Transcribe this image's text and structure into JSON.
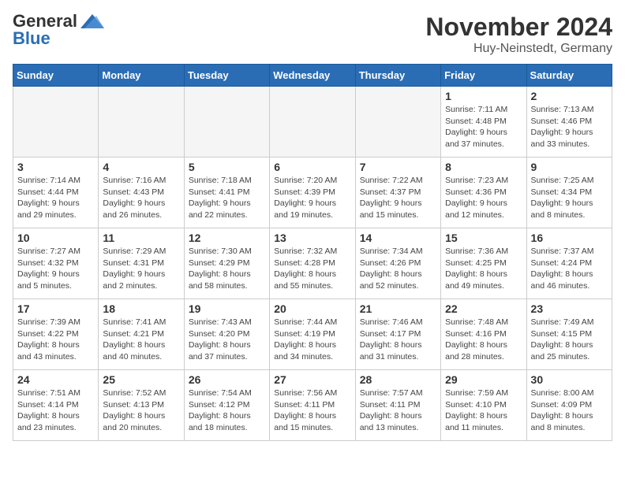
{
  "header": {
    "logo_general": "General",
    "logo_blue": "Blue",
    "month": "November 2024",
    "location": "Huy-Neinstedt, Germany"
  },
  "weekdays": [
    "Sunday",
    "Monday",
    "Tuesday",
    "Wednesday",
    "Thursday",
    "Friday",
    "Saturday"
  ],
  "weeks": [
    [
      {
        "day": "",
        "info": ""
      },
      {
        "day": "",
        "info": ""
      },
      {
        "day": "",
        "info": ""
      },
      {
        "day": "",
        "info": ""
      },
      {
        "day": "",
        "info": ""
      },
      {
        "day": "1",
        "info": "Sunrise: 7:11 AM\nSunset: 4:48 PM\nDaylight: 9 hours\nand 37 minutes."
      },
      {
        "day": "2",
        "info": "Sunrise: 7:13 AM\nSunset: 4:46 PM\nDaylight: 9 hours\nand 33 minutes."
      }
    ],
    [
      {
        "day": "3",
        "info": "Sunrise: 7:14 AM\nSunset: 4:44 PM\nDaylight: 9 hours\nand 29 minutes."
      },
      {
        "day": "4",
        "info": "Sunrise: 7:16 AM\nSunset: 4:43 PM\nDaylight: 9 hours\nand 26 minutes."
      },
      {
        "day": "5",
        "info": "Sunrise: 7:18 AM\nSunset: 4:41 PM\nDaylight: 9 hours\nand 22 minutes."
      },
      {
        "day": "6",
        "info": "Sunrise: 7:20 AM\nSunset: 4:39 PM\nDaylight: 9 hours\nand 19 minutes."
      },
      {
        "day": "7",
        "info": "Sunrise: 7:22 AM\nSunset: 4:37 PM\nDaylight: 9 hours\nand 15 minutes."
      },
      {
        "day": "8",
        "info": "Sunrise: 7:23 AM\nSunset: 4:36 PM\nDaylight: 9 hours\nand 12 minutes."
      },
      {
        "day": "9",
        "info": "Sunrise: 7:25 AM\nSunset: 4:34 PM\nDaylight: 9 hours\nand 8 minutes."
      }
    ],
    [
      {
        "day": "10",
        "info": "Sunrise: 7:27 AM\nSunset: 4:32 PM\nDaylight: 9 hours\nand 5 minutes."
      },
      {
        "day": "11",
        "info": "Sunrise: 7:29 AM\nSunset: 4:31 PM\nDaylight: 9 hours\nand 2 minutes."
      },
      {
        "day": "12",
        "info": "Sunrise: 7:30 AM\nSunset: 4:29 PM\nDaylight: 8 hours\nand 58 minutes."
      },
      {
        "day": "13",
        "info": "Sunrise: 7:32 AM\nSunset: 4:28 PM\nDaylight: 8 hours\nand 55 minutes."
      },
      {
        "day": "14",
        "info": "Sunrise: 7:34 AM\nSunset: 4:26 PM\nDaylight: 8 hours\nand 52 minutes."
      },
      {
        "day": "15",
        "info": "Sunrise: 7:36 AM\nSunset: 4:25 PM\nDaylight: 8 hours\nand 49 minutes."
      },
      {
        "day": "16",
        "info": "Sunrise: 7:37 AM\nSunset: 4:24 PM\nDaylight: 8 hours\nand 46 minutes."
      }
    ],
    [
      {
        "day": "17",
        "info": "Sunrise: 7:39 AM\nSunset: 4:22 PM\nDaylight: 8 hours\nand 43 minutes."
      },
      {
        "day": "18",
        "info": "Sunrise: 7:41 AM\nSunset: 4:21 PM\nDaylight: 8 hours\nand 40 minutes."
      },
      {
        "day": "19",
        "info": "Sunrise: 7:43 AM\nSunset: 4:20 PM\nDaylight: 8 hours\nand 37 minutes."
      },
      {
        "day": "20",
        "info": "Sunrise: 7:44 AM\nSunset: 4:19 PM\nDaylight: 8 hours\nand 34 minutes."
      },
      {
        "day": "21",
        "info": "Sunrise: 7:46 AM\nSunset: 4:17 PM\nDaylight: 8 hours\nand 31 minutes."
      },
      {
        "day": "22",
        "info": "Sunrise: 7:48 AM\nSunset: 4:16 PM\nDaylight: 8 hours\nand 28 minutes."
      },
      {
        "day": "23",
        "info": "Sunrise: 7:49 AM\nSunset: 4:15 PM\nDaylight: 8 hours\nand 25 minutes."
      }
    ],
    [
      {
        "day": "24",
        "info": "Sunrise: 7:51 AM\nSunset: 4:14 PM\nDaylight: 8 hours\nand 23 minutes."
      },
      {
        "day": "25",
        "info": "Sunrise: 7:52 AM\nSunset: 4:13 PM\nDaylight: 8 hours\nand 20 minutes."
      },
      {
        "day": "26",
        "info": "Sunrise: 7:54 AM\nSunset: 4:12 PM\nDaylight: 8 hours\nand 18 minutes."
      },
      {
        "day": "27",
        "info": "Sunrise: 7:56 AM\nSunset: 4:11 PM\nDaylight: 8 hours\nand 15 minutes."
      },
      {
        "day": "28",
        "info": "Sunrise: 7:57 AM\nSunset: 4:11 PM\nDaylight: 8 hours\nand 13 minutes."
      },
      {
        "day": "29",
        "info": "Sunrise: 7:59 AM\nSunset: 4:10 PM\nDaylight: 8 hours\nand 11 minutes."
      },
      {
        "day": "30",
        "info": "Sunrise: 8:00 AM\nSunset: 4:09 PM\nDaylight: 8 hours\nand 8 minutes."
      }
    ]
  ]
}
